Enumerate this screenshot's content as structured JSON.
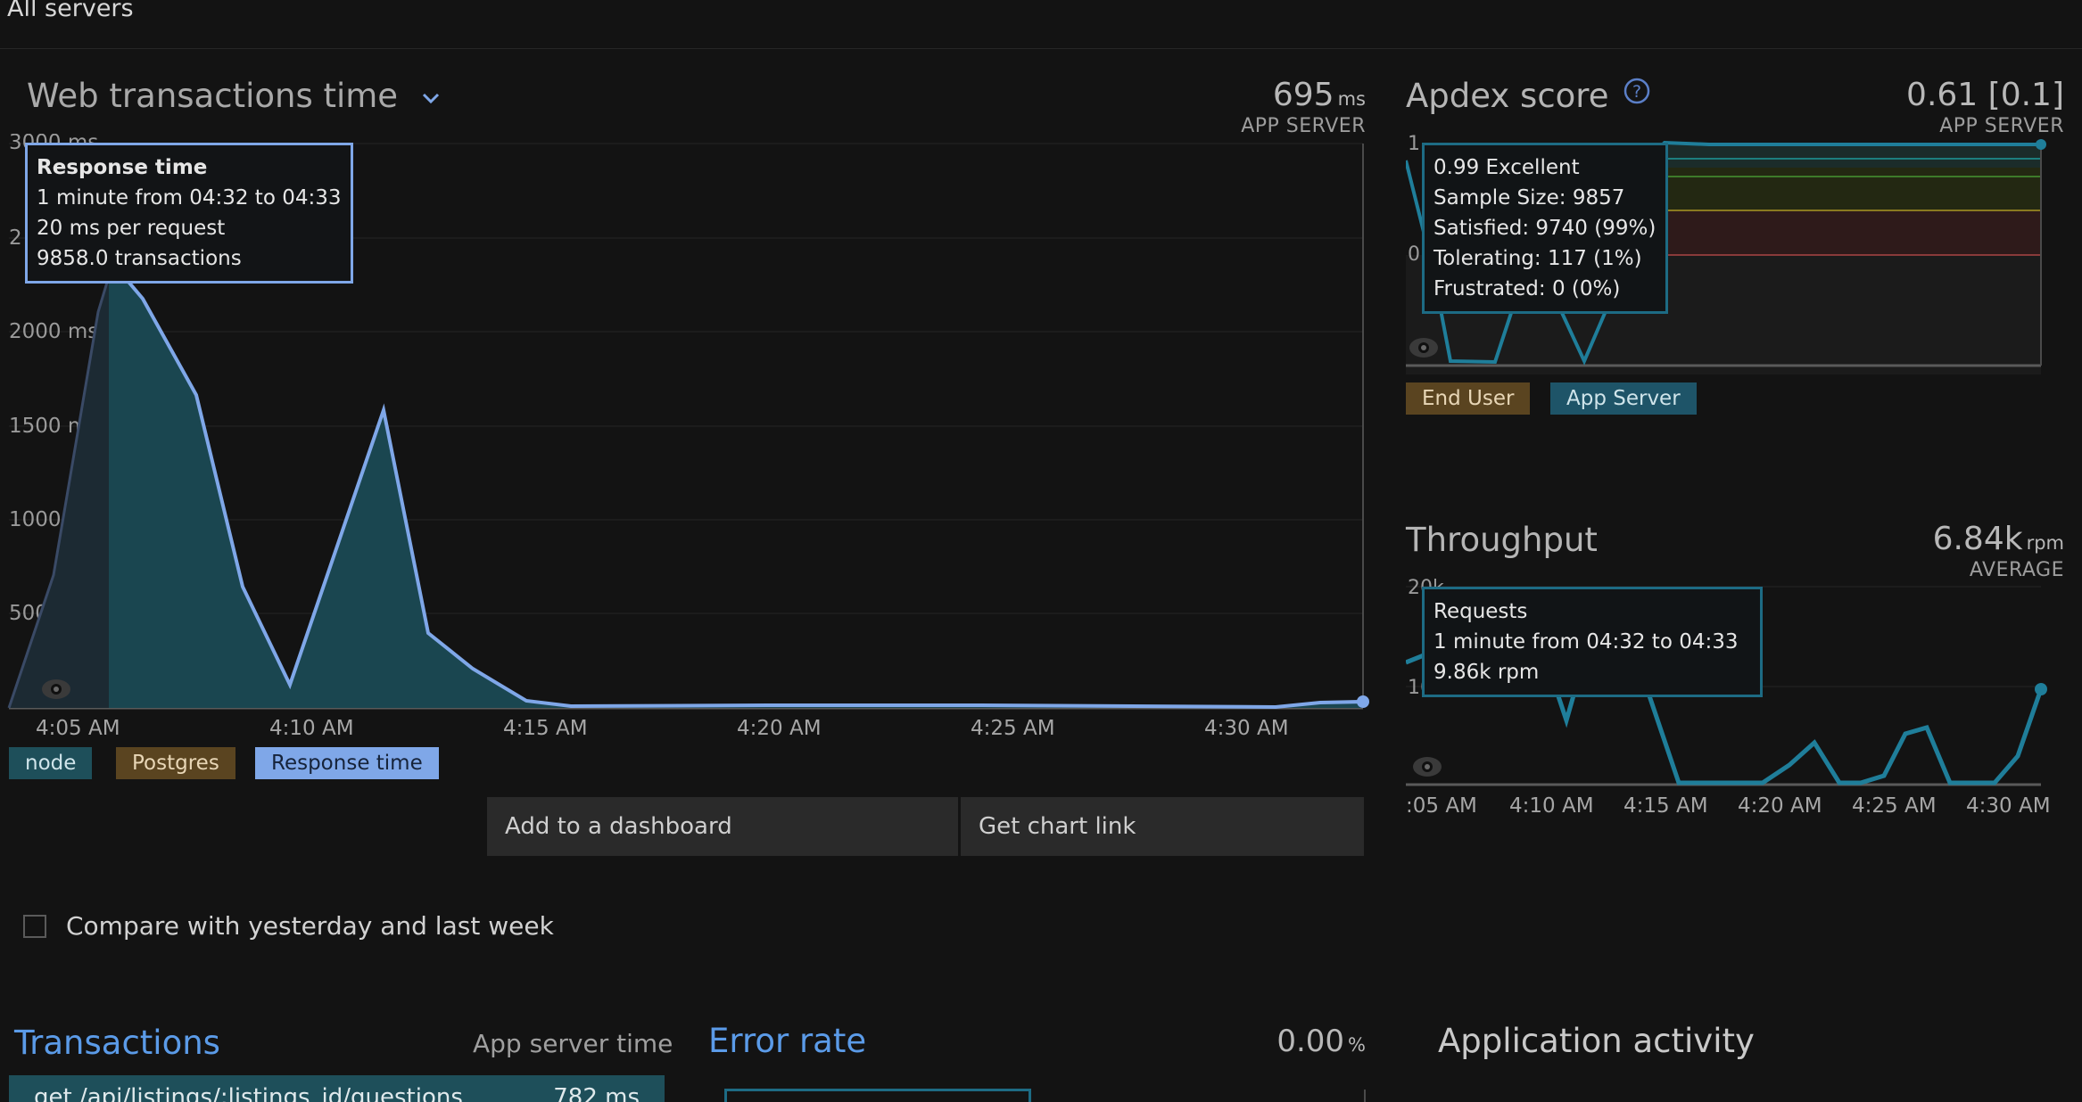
{
  "breadcrumb": "All servers",
  "web_tx": {
    "title": "Web transactions time",
    "value": "695",
    "unit": "ms",
    "subtitle": "APP SERVER",
    "y_ticks": [
      "3000 ms",
      "2",
      "2000 ms",
      "1500 ms",
      "1000 ms",
      "500 ms"
    ],
    "x_ticks": [
      "4:05 AM",
      "4:10 AM",
      "4:15 AM",
      "4:20 AM",
      "4:25 AM",
      "4:30 AM"
    ],
    "tooltip": {
      "title": "Response time",
      "line1": "1 minute from 04:32 to 04:33",
      "line2": "20 ms per request",
      "line3": "9858.0 transactions"
    },
    "legend": [
      {
        "label": "node",
        "color": "#1e4f5a"
      },
      {
        "label": "Postgres",
        "color": "#5a4420"
      },
      {
        "label": "Response time",
        "color": "#7fa7e8"
      }
    ]
  },
  "buttons": {
    "add_dashboard": "Add to a dashboard",
    "chart_link": "Get chart link"
  },
  "compare_label": "Compare with yesterday and last week",
  "apdex": {
    "title": "Apdex score",
    "value": "0.61 [0.1]",
    "subtitle": "APP SERVER",
    "y_ticks": [
      "1",
      "0"
    ],
    "tooltip": {
      "line1": "0.99 Excellent",
      "line2": "Sample Size: 9857",
      "line3": "Satisfied: 9740 (99%)",
      "line4": "Tolerating: 117 (1%)",
      "line5": "Frustrated: 0 (0%)"
    },
    "legend": [
      {
        "label": "End User",
        "color": "#5a4420"
      },
      {
        "label": "App Server",
        "color": "#1e5468"
      }
    ]
  },
  "throughput": {
    "title": "Throughput",
    "value": "6.84k",
    "unit": "rpm",
    "subtitle": "AVERAGE",
    "y_ticks": [
      "20k",
      "10"
    ],
    "x_ticks": [
      ":05 AM",
      "4:10 AM",
      "4:15 AM",
      "4:20 AM",
      "4:25 AM",
      "4:30 AM"
    ],
    "tooltip": {
      "line1": "Requests",
      "line2": "1 minute from 04:32 to 04:33",
      "line3": "9.86k rpm"
    }
  },
  "transactions": {
    "title": "Transactions",
    "column": "App server time",
    "row_name": "get /api/listings/:listings_id/questions",
    "row_value": "782 ms"
  },
  "error_rate": {
    "title": "Error rate",
    "value": "0.00",
    "unit": "%"
  },
  "activity": {
    "title": "Application activity"
  },
  "colors": {
    "accent_blue": "#7fa7e8",
    "teal": "#1f7e9a",
    "link_blue": "#5b9be8"
  }
}
